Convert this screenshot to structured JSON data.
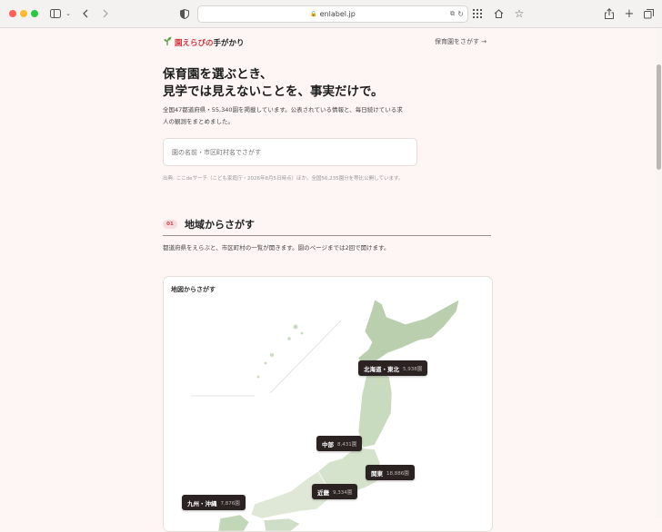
{
  "browser": {
    "url": "enlabel.jp"
  },
  "header": {
    "logo_red": "園えらびの",
    "logo_dark": "手がかり",
    "nav_link": "保育園をさがす →"
  },
  "hero": {
    "title_line1": "保育園を選ぶとき、",
    "title_line2": "見学では見えないことを、事実だけで。",
    "desc": "全国47都道府県・55,340園を掲載しています。公表されている情報と、毎日続けている求人の観測をまとめました。"
  },
  "search": {
    "placeholder": "園の名前・市区町村名でさがす"
  },
  "source_note": "出典: ここdeサーチ（こども家庭庁・2026年8月5日時点）ほか。全国56,235園分を等比公開しています。",
  "section1": {
    "number": "01",
    "title": "地域からさがす",
    "desc": "都道府県をえらぶと、市区町村の一覧が開きます。園のページまでは2回で開けます。"
  },
  "map": {
    "card_title": "地図からさがす",
    "regions": [
      {
        "name": "北海道・東北",
        "count": "5,938園"
      },
      {
        "name": "中部",
        "count": "8,431園"
      },
      {
        "name": "関東",
        "count": "18,886園"
      },
      {
        "name": "近畿",
        "count": "9,334園"
      },
      {
        "name": "九州・沖縄",
        "count": "7,876園"
      }
    ]
  }
}
